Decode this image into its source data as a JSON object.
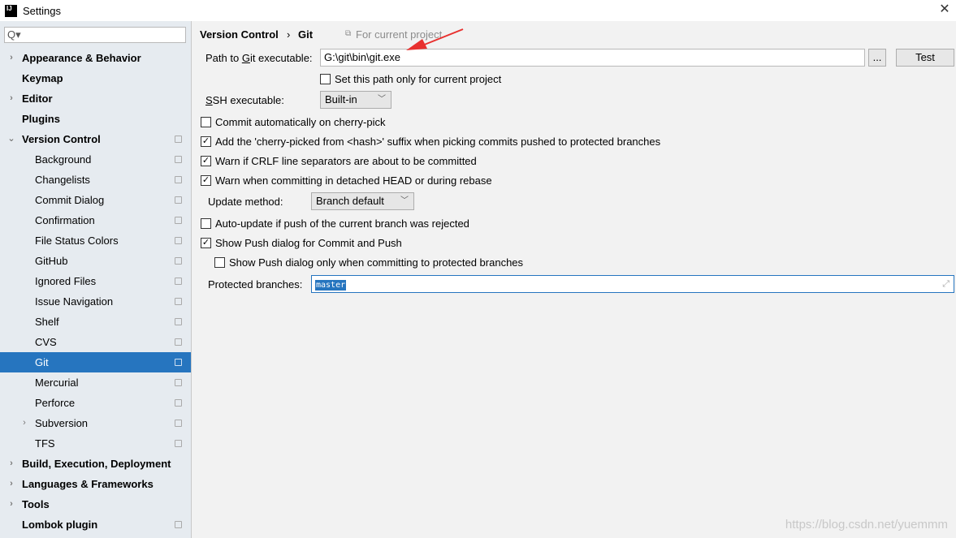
{
  "window": {
    "title": "Settings",
    "logo": "IJ",
    "close_icon": "close-icon"
  },
  "sidebar": {
    "search_placeholder": "Q▾",
    "selected": "Git",
    "items": [
      {
        "label": "Appearance & Behavior",
        "level": 0,
        "bold": true,
        "expandable": true,
        "expanded": false,
        "cfg": false
      },
      {
        "label": "Keymap",
        "level": 0,
        "bold": true,
        "expandable": false,
        "cfg": false
      },
      {
        "label": "Editor",
        "level": 0,
        "bold": true,
        "expandable": true,
        "expanded": false,
        "cfg": false
      },
      {
        "label": "Plugins",
        "level": 0,
        "bold": true,
        "expandable": false,
        "cfg": false
      },
      {
        "label": "Version Control",
        "level": 0,
        "bold": true,
        "expandable": true,
        "expanded": true,
        "cfg": true
      },
      {
        "label": "Background",
        "level": 1,
        "cfg": true
      },
      {
        "label": "Changelists",
        "level": 1,
        "cfg": true
      },
      {
        "label": "Commit Dialog",
        "level": 1,
        "cfg": true
      },
      {
        "label": "Confirmation",
        "level": 1,
        "cfg": true
      },
      {
        "label": "File Status Colors",
        "level": 1,
        "cfg": true
      },
      {
        "label": "GitHub",
        "level": 1,
        "cfg": true
      },
      {
        "label": "Ignored Files",
        "level": 1,
        "cfg": true
      },
      {
        "label": "Issue Navigation",
        "level": 1,
        "cfg": true
      },
      {
        "label": "Shelf",
        "level": 1,
        "cfg": true
      },
      {
        "label": "CVS",
        "level": 1,
        "cfg": true
      },
      {
        "label": "Git",
        "level": 1,
        "cfg": true,
        "selected": true
      },
      {
        "label": "Mercurial",
        "level": 1,
        "cfg": true
      },
      {
        "label": "Perforce",
        "level": 1,
        "cfg": true
      },
      {
        "label": "Subversion",
        "level": 1,
        "expandable": true,
        "expanded": false,
        "cfg": true
      },
      {
        "label": "TFS",
        "level": 1,
        "cfg": true
      },
      {
        "label": "Build, Execution, Deployment",
        "level": 0,
        "bold": true,
        "expandable": true,
        "expanded": false,
        "cfg": false
      },
      {
        "label": "Languages & Frameworks",
        "level": 0,
        "bold": true,
        "expandable": true,
        "expanded": false,
        "cfg": false
      },
      {
        "label": "Tools",
        "level": 0,
        "bold": true,
        "expandable": true,
        "expanded": false,
        "cfg": false
      },
      {
        "label": "Lombok plugin",
        "level": 0,
        "bold": true,
        "expandable": false,
        "cfg": true
      }
    ]
  },
  "main": {
    "breadcrumb": [
      "Version Control",
      "Git"
    ],
    "breadcrumb_sep": "›",
    "scope_label": "For current project",
    "git_path_label_pre": "Path to ",
    "git_path_label_u": "G",
    "git_path_label_post": "it executable:",
    "git_path_value": "G:\\git\\bin\\git.exe",
    "browse_label": "...",
    "test_label": "Test",
    "set_path_only": {
      "label": "Set this path only for current project",
      "checked": false
    },
    "ssh_label_u": "S",
    "ssh_label_post": "SH executable:",
    "ssh_value": "Built-in",
    "options": [
      {
        "label": "Commit automatically on cherry-pick",
        "checked": false
      },
      {
        "label": "Add the 'cherry-picked from <hash>' suffix when picking commits pushed to protected branches",
        "checked": true
      },
      {
        "label": "Warn if CRLF line separators are about to be committed",
        "checked": true
      },
      {
        "label": "Warn when committing in detached HEAD or during rebase",
        "checked": true
      }
    ],
    "update_method_label": "Update method:",
    "update_method_value": "Branch default",
    "auto_update": {
      "label": "Auto-update if push of the current branch was rejected",
      "checked": false
    },
    "show_push": {
      "label": "Show Push dialog for Commit and Push",
      "checked": true
    },
    "show_push_protected": {
      "label": "Show Push dialog only when committing to protected branches",
      "checked": false
    },
    "protected_label": "Protected branches:",
    "protected_value": "master"
  },
  "watermark": "https://blog.csdn.net/yuemmm",
  "colors": {
    "selection": "#2675bf",
    "sidebar_bg": "#e6ebf0",
    "main_bg": "#f2f2f2",
    "annotation_arrow": "#e8312f"
  }
}
